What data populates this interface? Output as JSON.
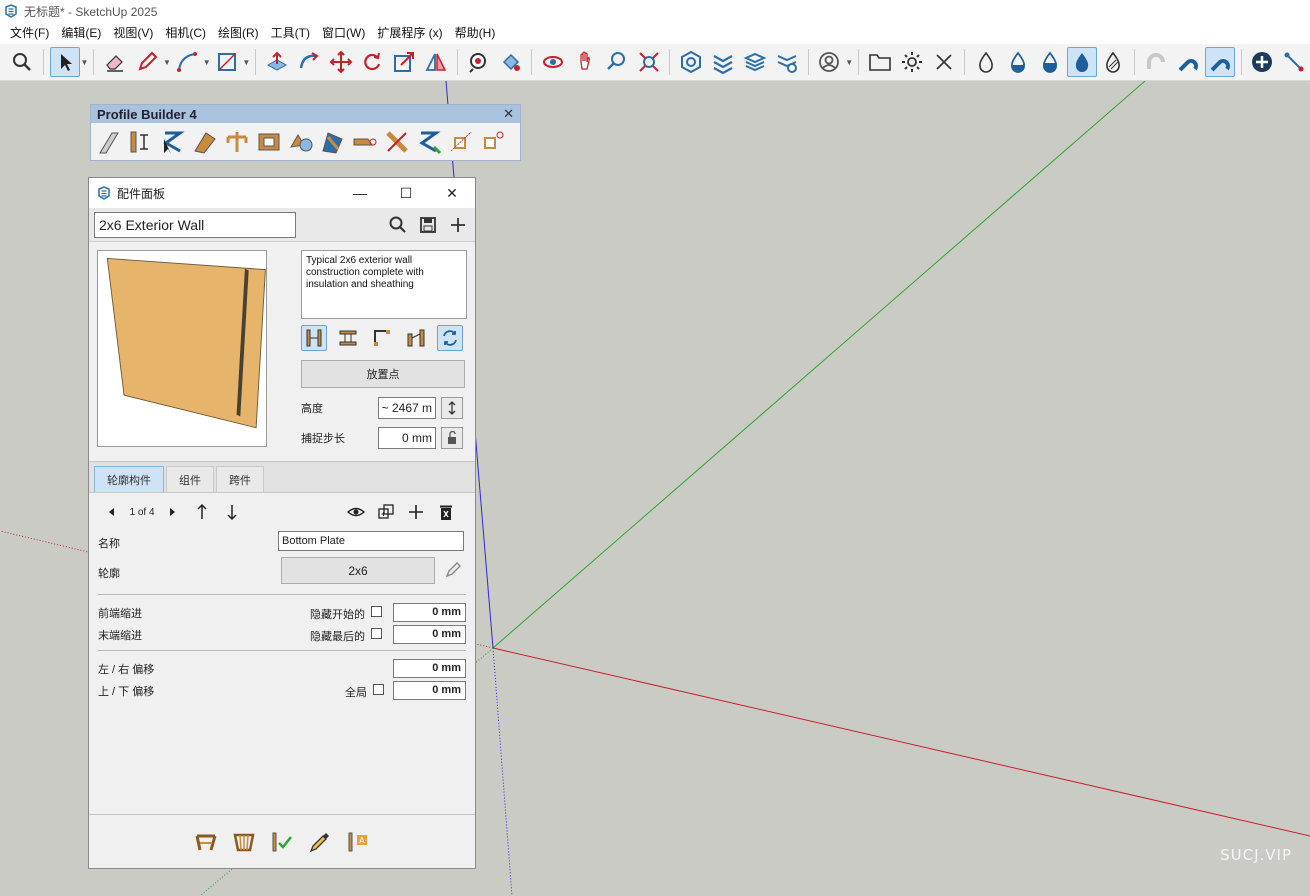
{
  "window": {
    "title": "无标题* - SketchUp 2025"
  },
  "menu": {
    "items": [
      "文件(F)",
      "编辑(E)",
      "视图(V)",
      "相机(C)",
      "绘图(R)",
      "工具(T)",
      "窗口(W)",
      "扩展程序 (x)",
      "帮助(H)"
    ]
  },
  "profile_builder": {
    "title": "Profile Builder 4"
  },
  "panel": {
    "title": "配件面板",
    "assembly_name": "2x6 Exterior Wall",
    "description": "Typical 2x6 exterior wall construction complete with insulation and sheathing",
    "place_button": "放置点",
    "height_label": "高度",
    "height_value": "~ 2467 m",
    "snap_label": "捕捉步长",
    "snap_value": "0 mm",
    "tabs": [
      "轮廓构件",
      "组件",
      "跨件"
    ],
    "active_tab": "轮廓构件",
    "pager": "1 of 4",
    "name_label": "名称",
    "name_value": "Bottom Plate",
    "profile_label": "轮廓",
    "profile_value": "2x6",
    "front_indent_label": "前端缩进",
    "hide_start_label": "隐藏开始的",
    "front_indent_value": "0 mm",
    "end_indent_label": "末端缩进",
    "hide_end_label": "隐藏最后的",
    "end_indent_value": "0 mm",
    "lr_offset_label": "左 / 右 偏移",
    "lr_offset_value": "0 mm",
    "ud_offset_label": "上 / 下 偏移",
    "global_label": "全局",
    "ud_offset_value": "0 mm"
  },
  "watermark": "SUCJ.VIP",
  "colors": {
    "viewport_bg": "#cbcbc6",
    "accent_active": "#cfe3f7",
    "axis_red": "#c8202b",
    "axis_green": "#2fa32f",
    "axis_blue": "#2b2bd0",
    "wall_fill": "#e6b46a"
  }
}
